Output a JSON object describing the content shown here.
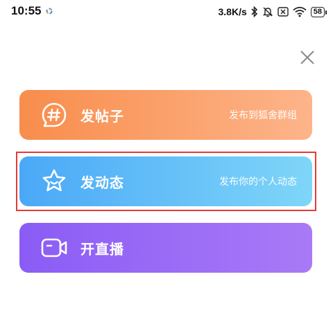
{
  "status_bar": {
    "time": "10:55",
    "network_speed": "3.8K/s",
    "battery": "58",
    "icons": [
      "bluetooth-icon",
      "mute-icon",
      "no-sim-icon",
      "wifi-icon",
      "battery-icon"
    ]
  },
  "close_icon": "close-icon",
  "cards": [
    {
      "title": "发帖子",
      "subtitle": "发布到狐舍群组",
      "icon": "hashtag-chat-icon",
      "color_start": "#f88d4c",
      "color_end": "#fdb48a"
    },
    {
      "title": "发动态",
      "subtitle": "发布你的个人动态",
      "icon": "star-face-icon",
      "color_start": "#4aa8f7",
      "color_end": "#7fd6f8"
    },
    {
      "title": "开直播",
      "subtitle": "",
      "icon": "video-camera-icon",
      "color_start": "#8b5cf5",
      "color_end": "#a97af6"
    }
  ],
  "highlight_color": "#e53935"
}
